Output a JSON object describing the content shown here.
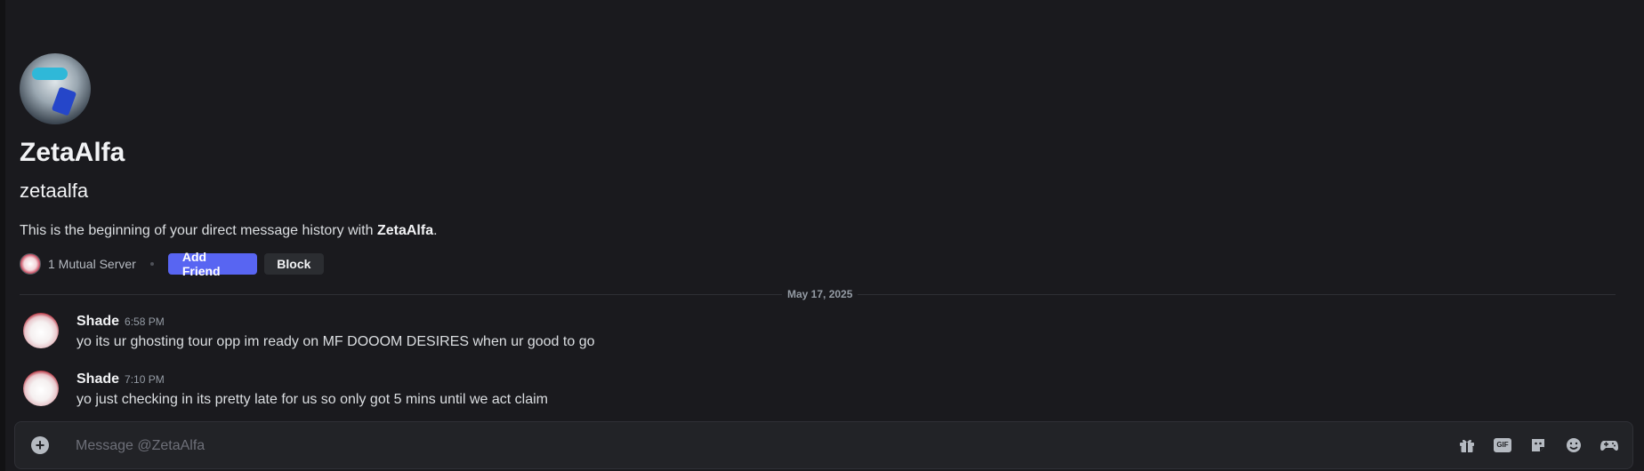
{
  "profile": {
    "display_name": "ZetaAlfa",
    "username": "zetaalfa",
    "intro_prefix": "This is the beginning of your direct message history with ",
    "intro_name": "ZetaAlfa",
    "intro_suffix": ".",
    "mutual_servers": "1 Mutual Server",
    "add_friend_label": "Add Friend",
    "block_label": "Block"
  },
  "divider": {
    "date": "May 17, 2025"
  },
  "messages": [
    {
      "author": "Shade",
      "time": "6:58 PM",
      "text": "yo its ur ghosting tour opp im ready on MF DOOOM DESIRES when ur good to go"
    },
    {
      "author": "Shade",
      "time": "7:10 PM",
      "text": "yo just checking in its pretty late for us so only got 5 mins until we act claim"
    }
  ],
  "composer": {
    "placeholder": "Message @ZetaAlfa",
    "gif_label": "GIF",
    "tools": [
      "gift-icon",
      "gif-icon",
      "sticker-icon",
      "emoji-icon",
      "activities-icon"
    ]
  },
  "colors": {
    "accent": "#5865f2",
    "background": "#1a1a1e"
  }
}
